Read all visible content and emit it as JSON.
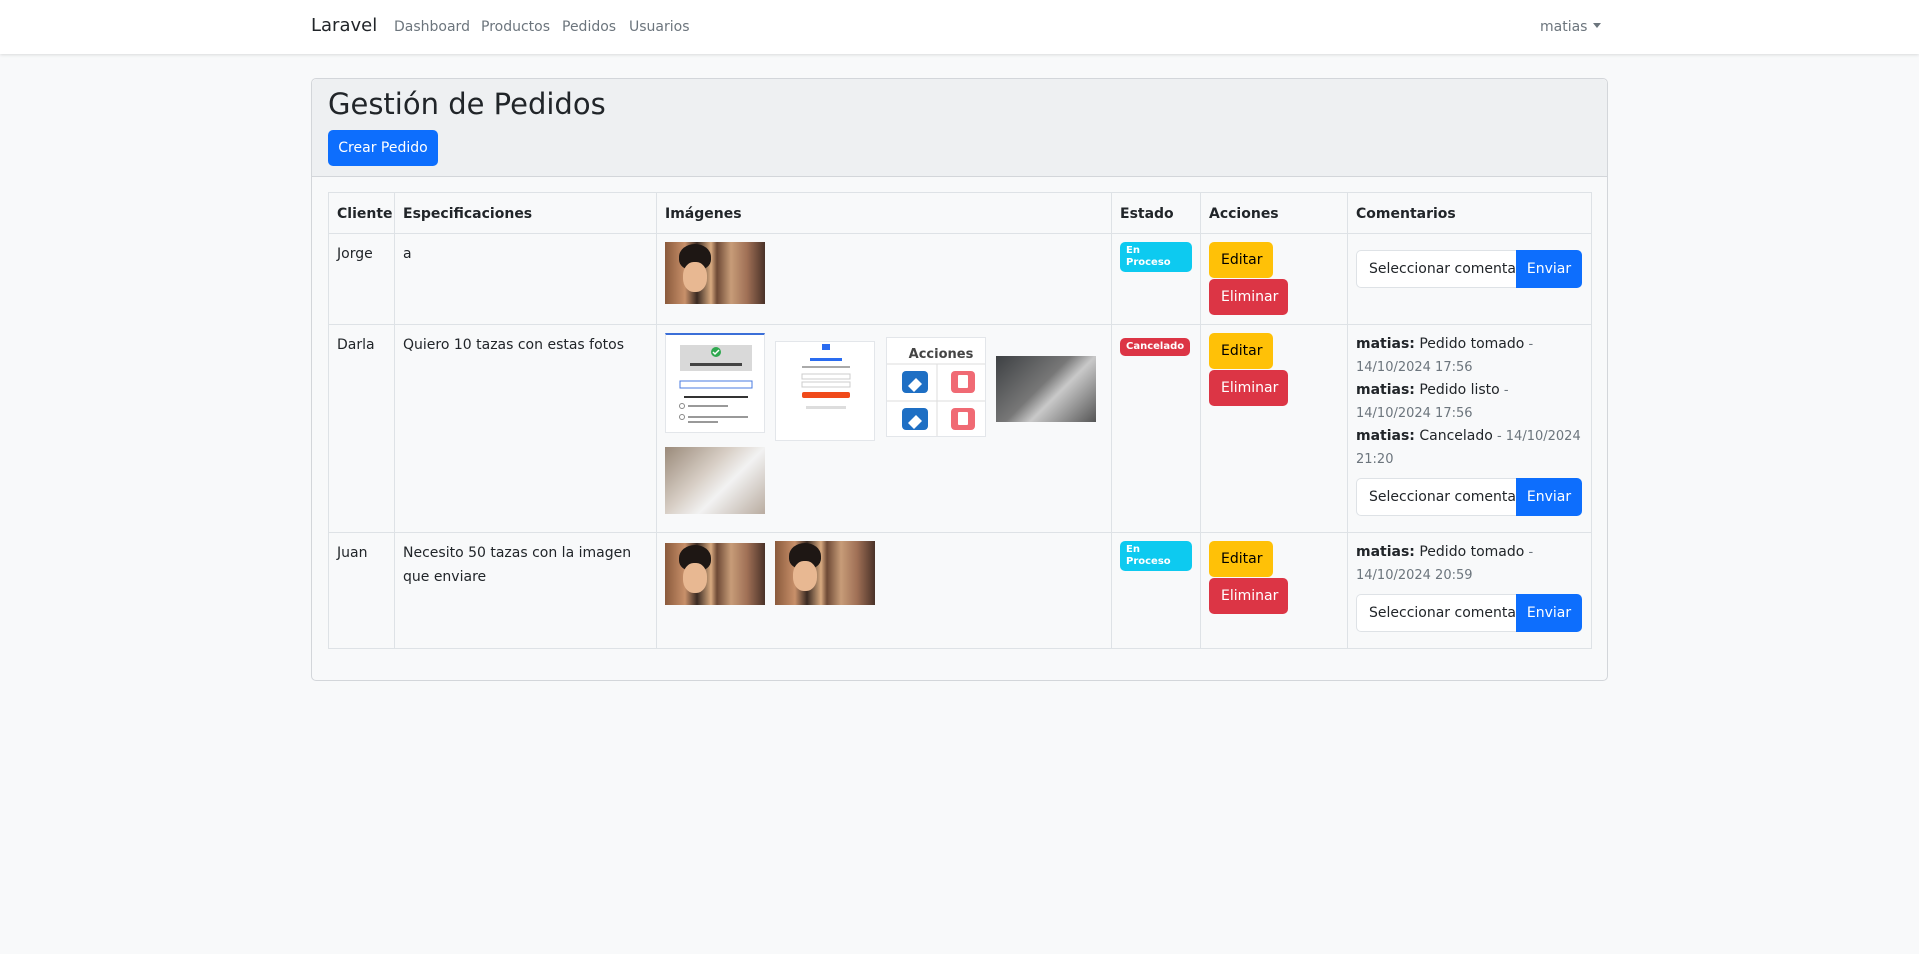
{
  "nav": {
    "brand": "Laravel",
    "links": [
      "Dashboard",
      "Productos",
      "Pedidos",
      "Usuarios"
    ],
    "user": "matias"
  },
  "page": {
    "title": "Gestión de Pedidos",
    "create_button": "Crear Pedido"
  },
  "table": {
    "headers": [
      "Cliente",
      "Especificaciones",
      "Imágenes",
      "Estado",
      "Acciones",
      "Comentarios"
    ],
    "edit_label": "Editar",
    "delete_label": "Eliminar",
    "comment_placeholder": "Seleccionar comenta",
    "send_label": "Enviar",
    "rows": [
      {
        "client": "Jorge",
        "specs": "a",
        "images": [
          "portrait-photo"
        ],
        "status": "En Proceso",
        "status_color": "#0dcaf0",
        "comments": []
      },
      {
        "client": "Darla",
        "specs": "Quiero 10 tazas con estas fotos",
        "images": [
          "payment-screenshot",
          "payment-form-screenshot",
          "actions-icons-screenshot",
          "clinic-photo",
          "clinic-photo"
        ],
        "status": "Cancelado",
        "status_color": "#dc3545",
        "comments": [
          {
            "author": "matias:",
            "text": " Pedido tomado",
            "meta": " - 14/10/2024 17:56"
          },
          {
            "author": "matias:",
            "text": " Pedido listo",
            "meta": " - 14/10/2024 17:56"
          },
          {
            "author": "matias:",
            "text": " Cancelado",
            "meta": " - 14/10/2024 21:20"
          }
        ]
      },
      {
        "client": "Juan",
        "specs": "Necesito 50 tazas con la imagen que enviare",
        "images": [
          "portrait-photo",
          "portrait-photo"
        ],
        "status": "En Proceso",
        "status_color": "#0dcaf0",
        "comments": [
          {
            "author": "matias:",
            "text": " Pedido tomado",
            "meta": " - 14/10/2024 20:59"
          }
        ]
      }
    ]
  },
  "thumbnail_texts": {
    "actions_title": "Acciones"
  }
}
